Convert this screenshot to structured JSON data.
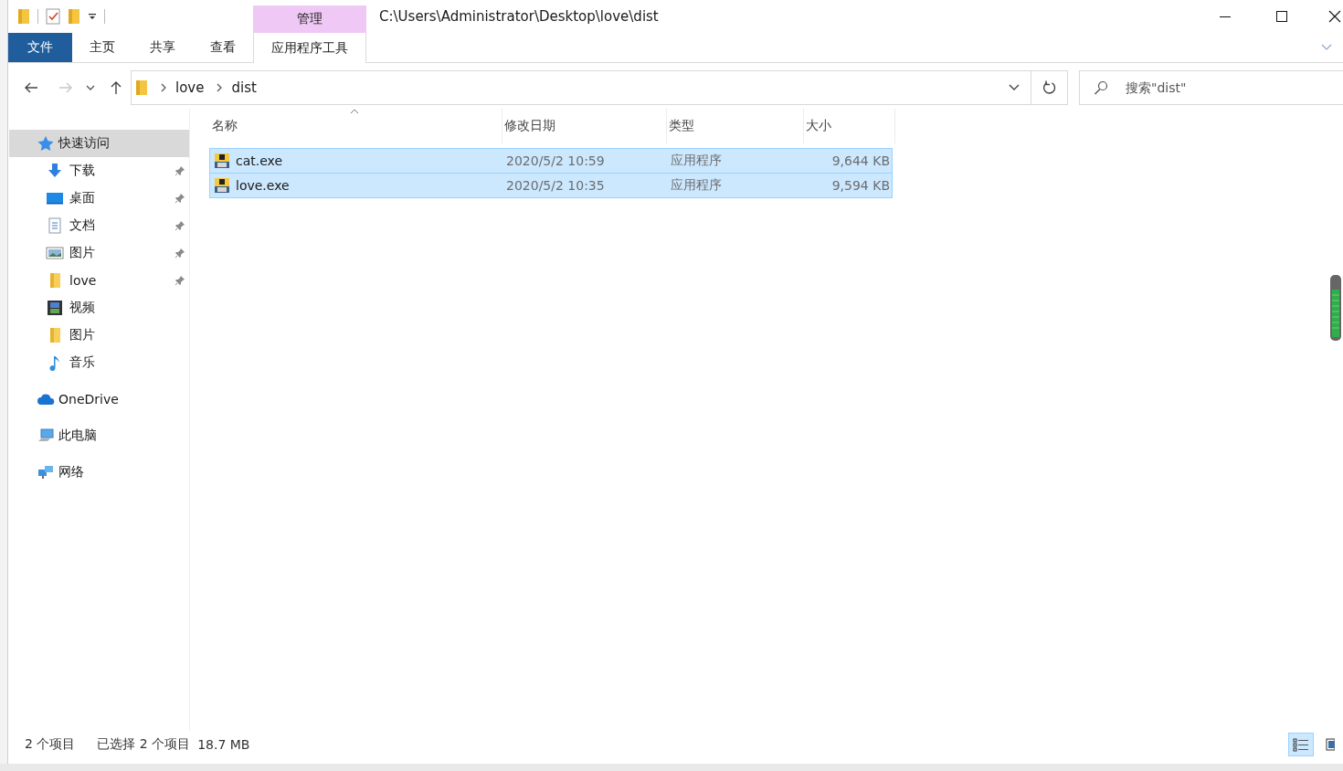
{
  "window": {
    "title": "C:\\Users\\Administrator\\Desktop\\love\\dist"
  },
  "ribbon": {
    "context_label": "管理",
    "tabs": [
      {
        "label": "文件",
        "kind": "file",
        "selected": false
      },
      {
        "label": "主页",
        "kind": "tab",
        "selected": false
      },
      {
        "label": "共享",
        "kind": "tab",
        "selected": false
      },
      {
        "label": "查看",
        "kind": "tab",
        "selected": false
      },
      {
        "label": "应用程序工具",
        "kind": "context",
        "selected": true
      }
    ]
  },
  "address": {
    "breadcrumb": [
      "love",
      "dist"
    ]
  },
  "search": {
    "placeholder": "搜索\"dist\""
  },
  "sidebar": {
    "items": [
      {
        "label": "快速访问",
        "kind": "star",
        "selected": true,
        "children": [
          {
            "label": "下载",
            "kind": "download",
            "pinned": true,
            "selected": false
          },
          {
            "label": "桌面",
            "kind": "desktop",
            "pinned": true,
            "selected": false
          },
          {
            "label": "文档",
            "kind": "document",
            "pinned": true,
            "selected": false
          },
          {
            "label": "图片",
            "kind": "pictures",
            "pinned": true,
            "selected": false
          },
          {
            "label": "love",
            "kind": "folder",
            "pinned": true,
            "selected": false
          },
          {
            "label": "视频",
            "kind": "video",
            "pinned": false,
            "selected": false
          },
          {
            "label": "图片",
            "kind": "folder",
            "pinned": false,
            "selected": false
          },
          {
            "label": "音乐",
            "kind": "music",
            "pinned": false,
            "selected": false
          }
        ]
      },
      {
        "label": "OneDrive",
        "kind": "cloud",
        "selected": false
      },
      {
        "label": "此电脑",
        "kind": "computer",
        "selected": false
      },
      {
        "label": "网络",
        "kind": "network",
        "selected": false
      }
    ]
  },
  "table": {
    "columns": [
      {
        "label": "名称",
        "sorted": true
      },
      {
        "label": "修改日期",
        "sorted": false
      },
      {
        "label": "类型",
        "sorted": false
      },
      {
        "label": "大小",
        "sorted": false
      }
    ],
    "rows": [
      {
        "name": "cat.exe",
        "modified": "2020/5/2 10:59",
        "type": "应用程序",
        "size": "9,644 KB",
        "selected": true
      },
      {
        "name": "love.exe",
        "modified": "2020/5/2 10:35",
        "type": "应用程序",
        "size": "9,594 KB",
        "selected": true
      }
    ]
  },
  "status_bar": {
    "count": "2 个项目",
    "selection": "已选择 2 个项目",
    "size": "18.7 MB"
  }
}
